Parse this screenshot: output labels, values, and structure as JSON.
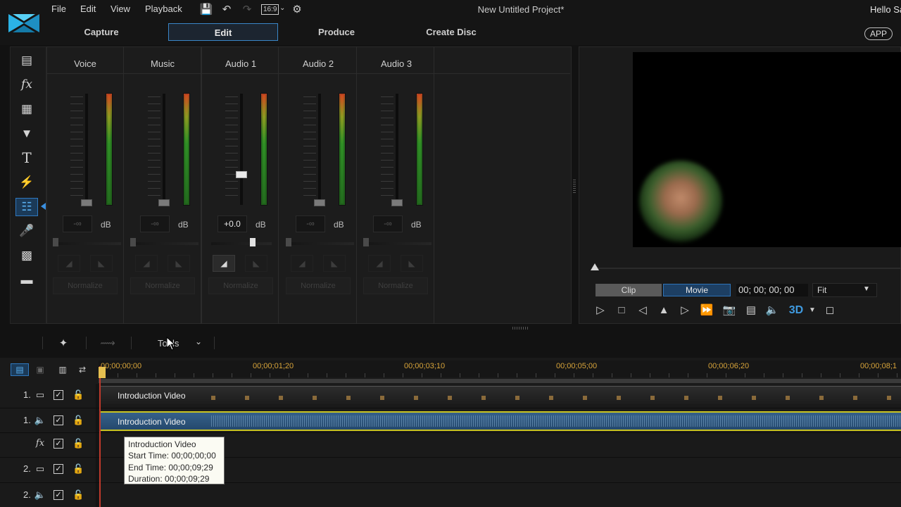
{
  "menu": {
    "file": "File",
    "edit": "Edit",
    "view": "View",
    "playback": "Playback",
    "aspect_ratio": "16:9"
  },
  "window": {
    "title": "New Untitled Project*",
    "user_greeting": "Hello Sa"
  },
  "mode_tabs": {
    "capture": "Capture",
    "edit": "Edit",
    "produce": "Produce",
    "create_disc": "Create Disc",
    "active": "Edit"
  },
  "app_button": "APP",
  "tool_icons": [
    "media-room-icon",
    "fx-icon",
    "pip-icon",
    "particle-icon",
    "title-icon",
    "transition-icon",
    "audio-mixer-icon",
    "voice-over-icon",
    "chapter-icon",
    "subtitle-icon"
  ],
  "mixer": {
    "db_unit": "dB",
    "normalize_label": "Normalize",
    "channels": [
      {
        "name": "Voice",
        "value": "-∞",
        "active": false
      },
      {
        "name": "Music",
        "value": "-∞",
        "active": false
      },
      {
        "name": "Audio 1",
        "value": "+0.0",
        "active": true
      },
      {
        "name": "Audio 2",
        "value": "-∞",
        "active": false
      },
      {
        "name": "Audio 3",
        "value": "-∞",
        "active": false
      }
    ]
  },
  "preview": {
    "clip_label": "Clip",
    "movie_label": "Movie",
    "active_mode": "Movie",
    "timecode": "00; 00; 00; 00",
    "zoom": "Fit",
    "three_d_label": "3D"
  },
  "toolbar": {
    "tools_label": "Tools"
  },
  "ruler": {
    "labels": [
      "00;00;00;00",
      "00;00;01;20",
      "00;00;03;10",
      "00;00;05;00",
      "00;00;06;20",
      "00;00;08;1"
    ]
  },
  "tracks": [
    {
      "num": "1.",
      "kind": "video",
      "checked": true
    },
    {
      "num": "1.",
      "kind": "audio",
      "checked": true
    },
    {
      "num": "",
      "kind": "fx",
      "checked": true
    },
    {
      "num": "2.",
      "kind": "video",
      "checked": true
    },
    {
      "num": "2.",
      "kind": "audio",
      "checked": true
    }
  ],
  "clips": {
    "video_clip_name": "Introduction Video",
    "audio_clip_name": "Introduction Video"
  },
  "tooltip": {
    "name": "Introduction Video",
    "start": "Start Time: 00;00;00;00",
    "end": "End Time: 00;00;09;29",
    "duration": "Duration: 00;00;09;29"
  },
  "colors": {
    "accent": "#2f78bf",
    "timecode_ruler": "#d8a43a",
    "audio_clip": "#2f5a84",
    "audio_border": "#c9c421",
    "playhead": "#c0392b"
  }
}
